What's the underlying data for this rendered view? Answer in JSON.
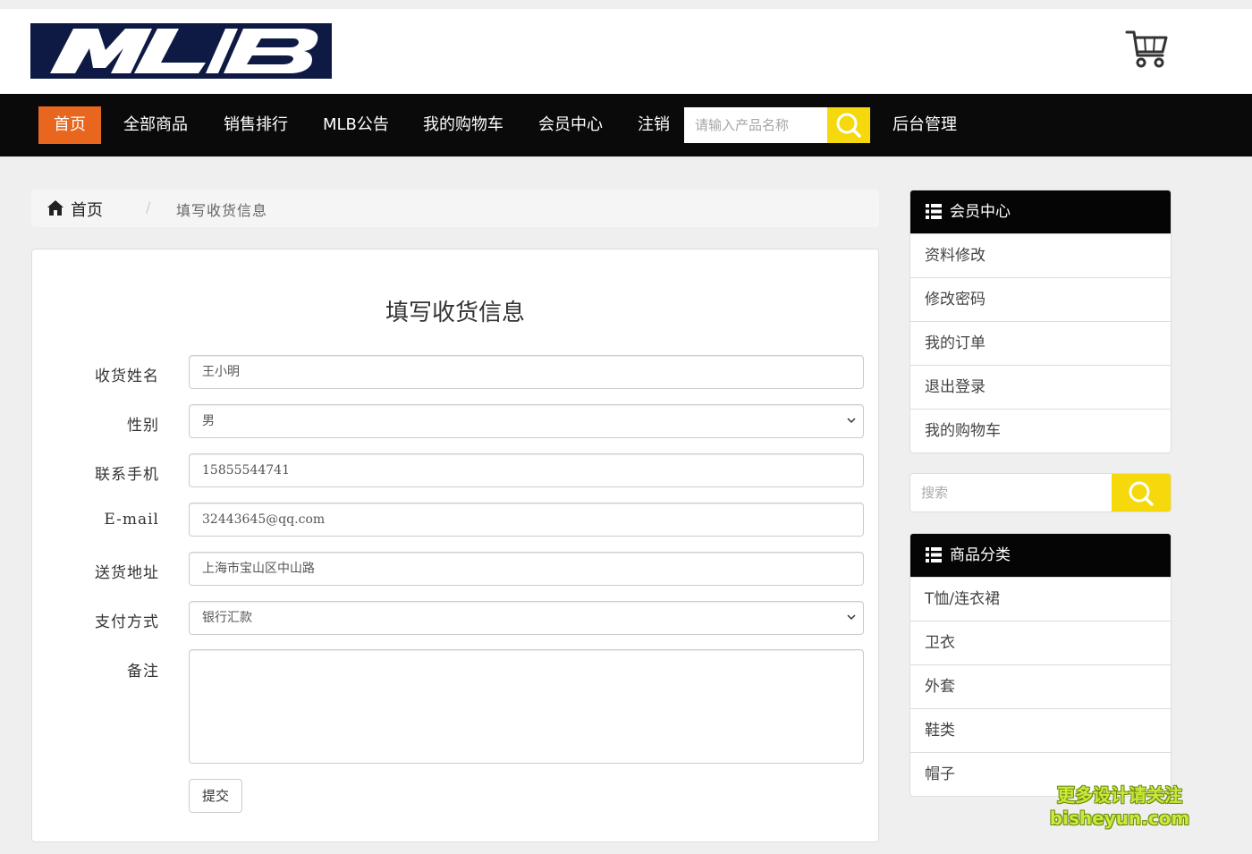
{
  "header": {
    "logo_text": "MLB",
    "cart_icon": "shopping-cart-icon"
  },
  "nav": {
    "items": [
      {
        "label": "首页",
        "active": true
      },
      {
        "label": "全部商品"
      },
      {
        "label": "销售排行"
      },
      {
        "label": "MLB公告"
      },
      {
        "label": "我的购物车"
      },
      {
        "label": "会员中心"
      },
      {
        "label": "注销"
      }
    ],
    "search_placeholder": "请输入产品名称",
    "admin_label": "后台管理"
  },
  "breadcrumb": {
    "home": "首页",
    "separator": "/",
    "current": "填写收货信息"
  },
  "form": {
    "title": "填写收货信息",
    "fields": [
      {
        "label": "收货姓名",
        "value": "王小明",
        "type": "text"
      },
      {
        "label": "性别",
        "value": "男",
        "type": "select"
      },
      {
        "label": "联系手机",
        "value": "15855544741",
        "type": "text"
      },
      {
        "label": "E-mail",
        "value": "32443645@qq.com",
        "type": "text"
      },
      {
        "label": "送货地址",
        "value": "上海市宝山区中山路",
        "type": "text"
      },
      {
        "label": "支付方式",
        "value": "银行汇款",
        "type": "select"
      },
      {
        "label": "备注",
        "value": "",
        "type": "textarea"
      }
    ],
    "submit_label": "提交"
  },
  "sidebar": {
    "member": {
      "title": "会员中心",
      "items": [
        "资料修改",
        "修改密码",
        "我的订单",
        "退出登录",
        "我的购物车"
      ]
    },
    "search_placeholder": "搜索",
    "categories": {
      "title": "商品分类",
      "items": [
        "T恤/连衣裙",
        "卫衣",
        "外套",
        "鞋类",
        "帽子"
      ]
    }
  },
  "watermark": {
    "line1": "更多设计请关注",
    "line2": "bisheyun.com"
  },
  "colors": {
    "nav_bg": "#0a0a0a",
    "active_nav": "#e8661e",
    "search_button": "#f5d90c",
    "logo_bg": "#0e1a43"
  }
}
